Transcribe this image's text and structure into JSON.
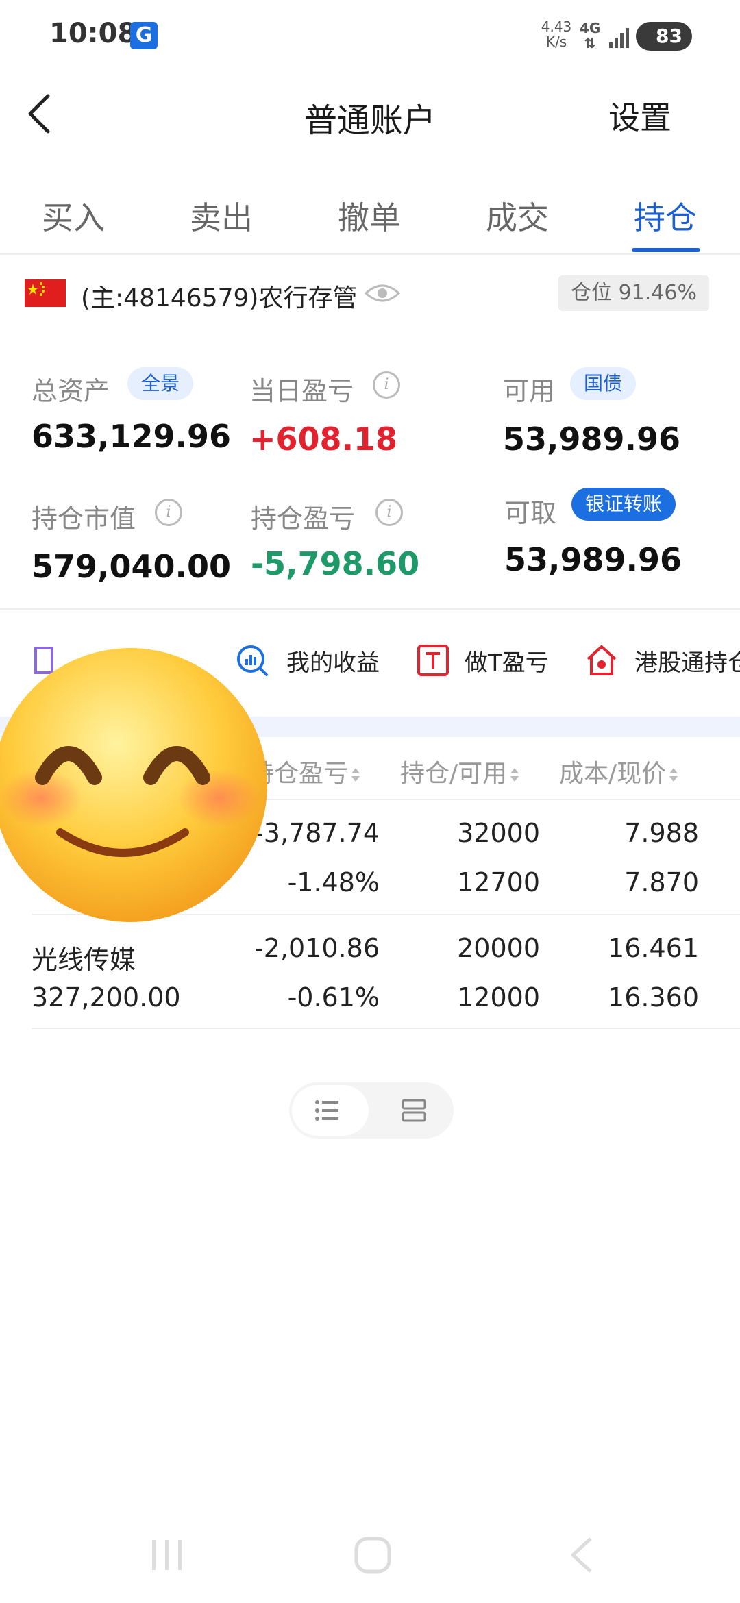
{
  "status_bar": {
    "time": "10:08",
    "app_badge": "G",
    "speed_value": "4.43",
    "speed_unit": "K/s",
    "network": "4G",
    "battery": "83"
  },
  "header": {
    "title": "普通账户",
    "settings_label": "设置"
  },
  "tabs": [
    {
      "label": "买入",
      "active": false
    },
    {
      "label": "卖出",
      "active": false
    },
    {
      "label": "撤单",
      "active": false
    },
    {
      "label": "成交",
      "active": false
    },
    {
      "label": "持仓",
      "active": true
    }
  ],
  "account": {
    "label": "(主:48146579)农行存管",
    "position_ratio": "仓位 91.46%"
  },
  "metrics": {
    "total_assets": {
      "label": "总资产",
      "pill": "全景",
      "value": "633,129.96"
    },
    "daily_pnl": {
      "label": "当日盈亏",
      "value": "+608.18"
    },
    "available": {
      "label": "可用",
      "pill": "国债",
      "value": "53,989.96"
    },
    "market_value": {
      "label": "持仓市值",
      "value": "579,040.00"
    },
    "position_pnl": {
      "label": "持仓盈亏",
      "value": "-5,798.60"
    },
    "withdrawable": {
      "label": "可取",
      "pill": "银证转账",
      "value": "53,989.96"
    }
  },
  "tools": [
    {
      "label": "我的收益",
      "icon": "chart-search-icon"
    },
    {
      "label": "做T盈亏",
      "icon": "t-box-icon"
    },
    {
      "label": "港股通持仓",
      "icon": "hk-house-icon"
    }
  ],
  "table": {
    "headers": [
      "持仓盈亏",
      "持仓/可用",
      "成本/现价"
    ],
    "rows": [
      {
        "name": "",
        "market_value": "",
        "pnl": "-3,787.74",
        "pnl_pct": "-1.48%",
        "hold": "32000",
        "avail": "12700",
        "cost": "7.988",
        "price": "7.870"
      },
      {
        "name": "光线传媒",
        "market_value": "327,200.00",
        "pnl": "-2,010.86",
        "pnl_pct": "-0.61%",
        "hold": "20000",
        "avail": "12000",
        "cost": "16.461",
        "price": "16.360"
      }
    ]
  },
  "colors": {
    "accent": "#1c5fd0",
    "up": "#e0232e",
    "down": "#1e9a6a"
  }
}
